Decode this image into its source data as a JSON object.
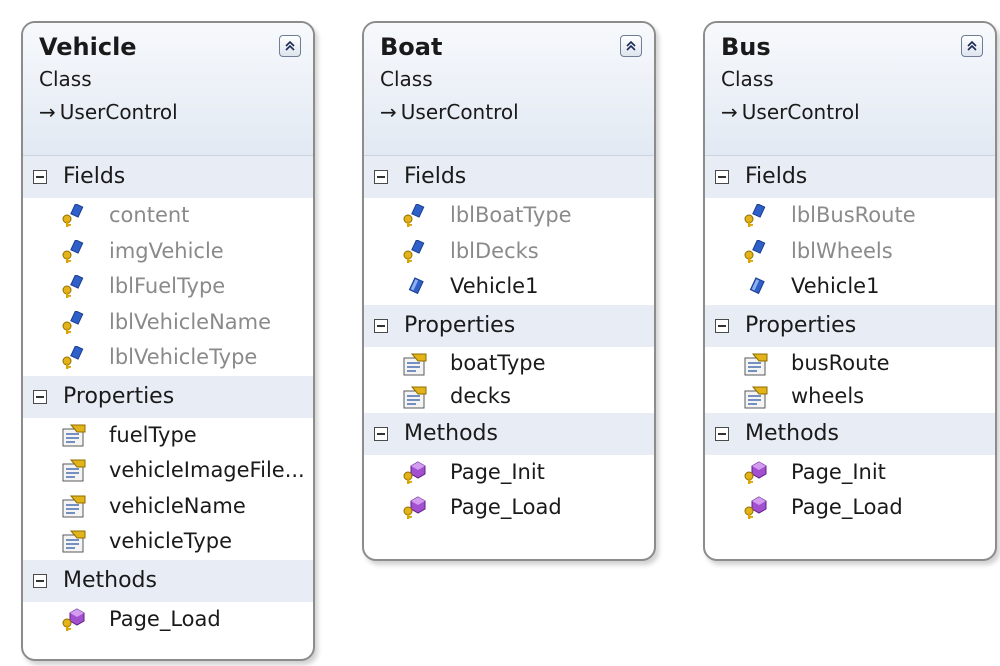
{
  "classes": [
    {
      "name": "Vehicle",
      "kind": "Class",
      "base": "UserControl",
      "sections": [
        {
          "label": "Fields",
          "items": [
            {
              "name": "content",
              "icon": "private-field-icon"
            },
            {
              "name": "imgVehicle",
              "icon": "private-field-icon"
            },
            {
              "name": "lblFuelType",
              "icon": "private-field-icon"
            },
            {
              "name": "lblVehicleName",
              "icon": "private-field-icon"
            },
            {
              "name": "lblVehicleType",
              "icon": "private-field-icon"
            }
          ]
        },
        {
          "label": "Properties",
          "items": [
            {
              "name": "fuelType",
              "icon": "property-icon"
            },
            {
              "name": "vehicleImageFile...",
              "icon": "property-icon"
            },
            {
              "name": "vehicleName",
              "icon": "property-icon"
            },
            {
              "name": "vehicleType",
              "icon": "property-icon"
            }
          ]
        },
        {
          "label": "Methods",
          "items": [
            {
              "name": "Page_Load",
              "icon": "protected-method-icon"
            }
          ]
        }
      ]
    },
    {
      "name": "Boat",
      "kind": "Class",
      "base": "UserControl",
      "sections": [
        {
          "label": "Fields",
          "items": [
            {
              "name": "lblBoatType",
              "icon": "private-field-icon"
            },
            {
              "name": "lblDecks",
              "icon": "private-field-icon"
            },
            {
              "name": "Vehicle1",
              "icon": "public-field-icon"
            }
          ]
        },
        {
          "label": "Properties",
          "items": [
            {
              "name": "boatType",
              "icon": "property-icon"
            },
            {
              "name": "decks",
              "icon": "property-icon"
            }
          ]
        },
        {
          "label": "Methods",
          "items": [
            {
              "name": "Page_Init",
              "icon": "protected-method-icon"
            },
            {
              "name": "Page_Load",
              "icon": "protected-method-icon"
            }
          ]
        }
      ]
    },
    {
      "name": "Bus",
      "kind": "Class",
      "base": "UserControl",
      "sections": [
        {
          "label": "Fields",
          "items": [
            {
              "name": "lblBusRoute",
              "icon": "private-field-icon"
            },
            {
              "name": "lblWheels",
              "icon": "private-field-icon"
            },
            {
              "name": "Vehicle1",
              "icon": "public-field-icon"
            }
          ]
        },
        {
          "label": "Properties",
          "items": [
            {
              "name": "busRoute",
              "icon": "property-icon"
            },
            {
              "name": "wheels",
              "icon": "property-icon"
            }
          ]
        },
        {
          "label": "Methods",
          "items": [
            {
              "name": "Page_Init",
              "icon": "protected-method-icon"
            },
            {
              "name": "Page_Load",
              "icon": "protected-method-icon"
            }
          ]
        }
      ]
    }
  ],
  "colors": {
    "field_blue": "#2f5fc8",
    "method_purple": "#a24fd0",
    "key_gold": "#d9a400",
    "private_text": "#8a8a8a"
  }
}
